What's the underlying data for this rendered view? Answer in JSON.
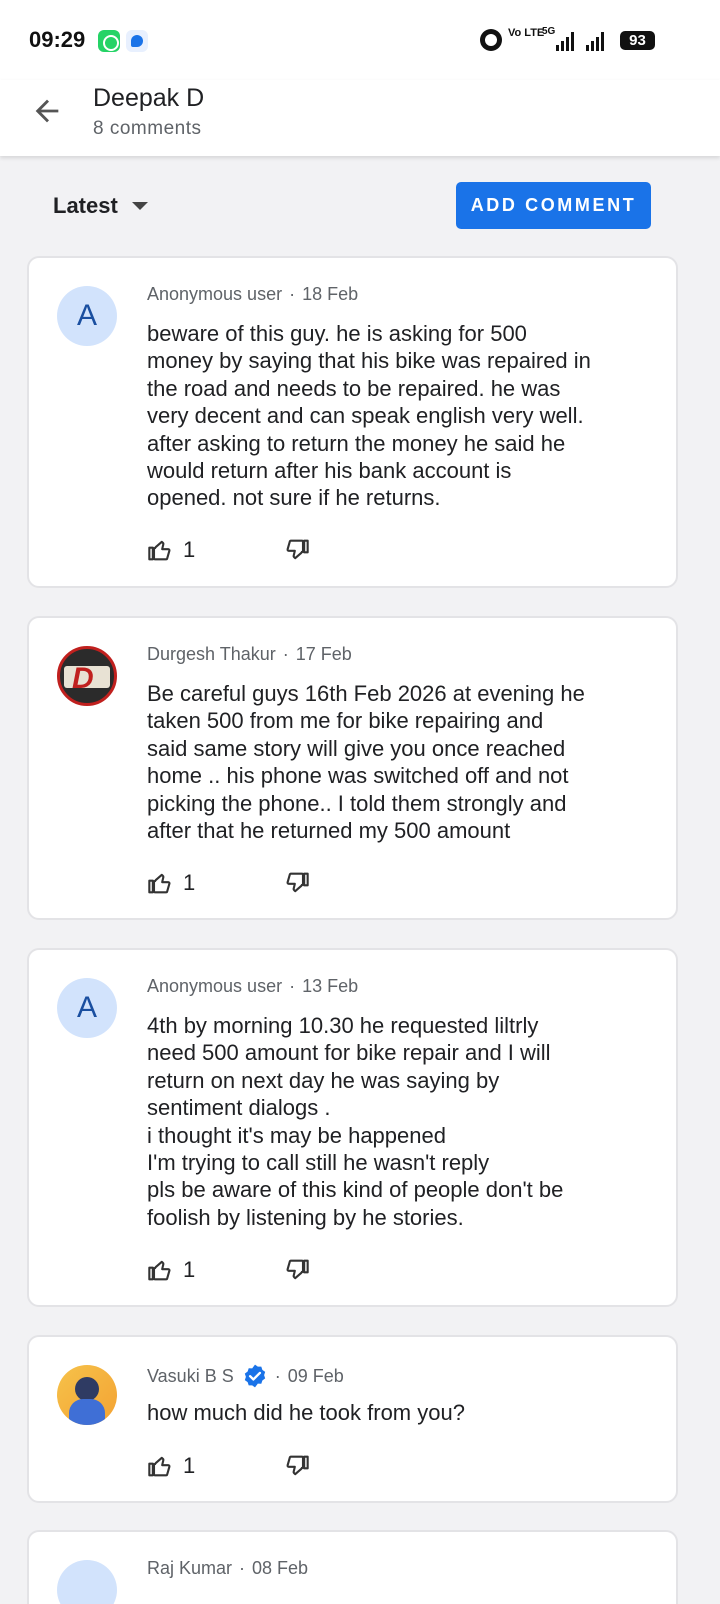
{
  "status_bar": {
    "time": "09:29",
    "volte": "Vo LTE",
    "network": "5G",
    "battery": "93",
    "icons": [
      "whatsapp-icon",
      "app-icon",
      "alarm-icon",
      "signal-icon",
      "battery-icon"
    ]
  },
  "header": {
    "title": "Deepak D",
    "subtitle": "8 comments",
    "back_icon": "arrow-back-icon"
  },
  "toolbar": {
    "sort_label": "Latest",
    "add_comment_label": "ADD COMMENT",
    "accent": "#1a73e8"
  },
  "comments": [
    {
      "author": "Anonymous user",
      "sep": "·",
      "date": "18 Feb",
      "avatar_letter": "A",
      "text": "beware of this guy. he is asking for 500\nmoney by saying that his bike was repaired in\nthe road and needs to be repaired. he was\nvery decent and can speak english very well.\nafter asking to return the money he said he\nwould return after his bank account is\nopened. not sure if he returns.",
      "likes": "1"
    },
    {
      "author": "Durgesh Thakur",
      "sep": "·",
      "date": "17 Feb",
      "avatar_letter": "",
      "text": "Be careful guys 16th Feb 2026 at evening he\ntaken 500 from me for bike repairing and\nsaid same story will give you once reached\nhome .. his phone was switched off and not\npicking the phone.. I told them strongly and\nafter that he returned my 500 amount",
      "likes": "1"
    },
    {
      "author": "Anonymous user",
      "sep": "·",
      "date": "13 Feb",
      "avatar_letter": "A",
      "text": "4th by morning 10.30 he requested liltrly\nneed 500 amount for bike repair and I will\nreturn on next day he was saying by\nsentiment dialogs .\ni thought it's may be happened\nI'm trying to call still he wasn't reply\npls be aware of this kind of people don't be\nfoolish by listening by he stories.",
      "likes": "1"
    },
    {
      "author": "Vasuki B S",
      "sep": "·",
      "date": "09 Feb",
      "avatar_letter": "",
      "verified": true,
      "text": "how much did he took from you?",
      "likes": "1"
    },
    {
      "author": "Raj Kumar",
      "sep": "·",
      "date": "08 Feb",
      "avatar_letter": ""
    }
  ]
}
